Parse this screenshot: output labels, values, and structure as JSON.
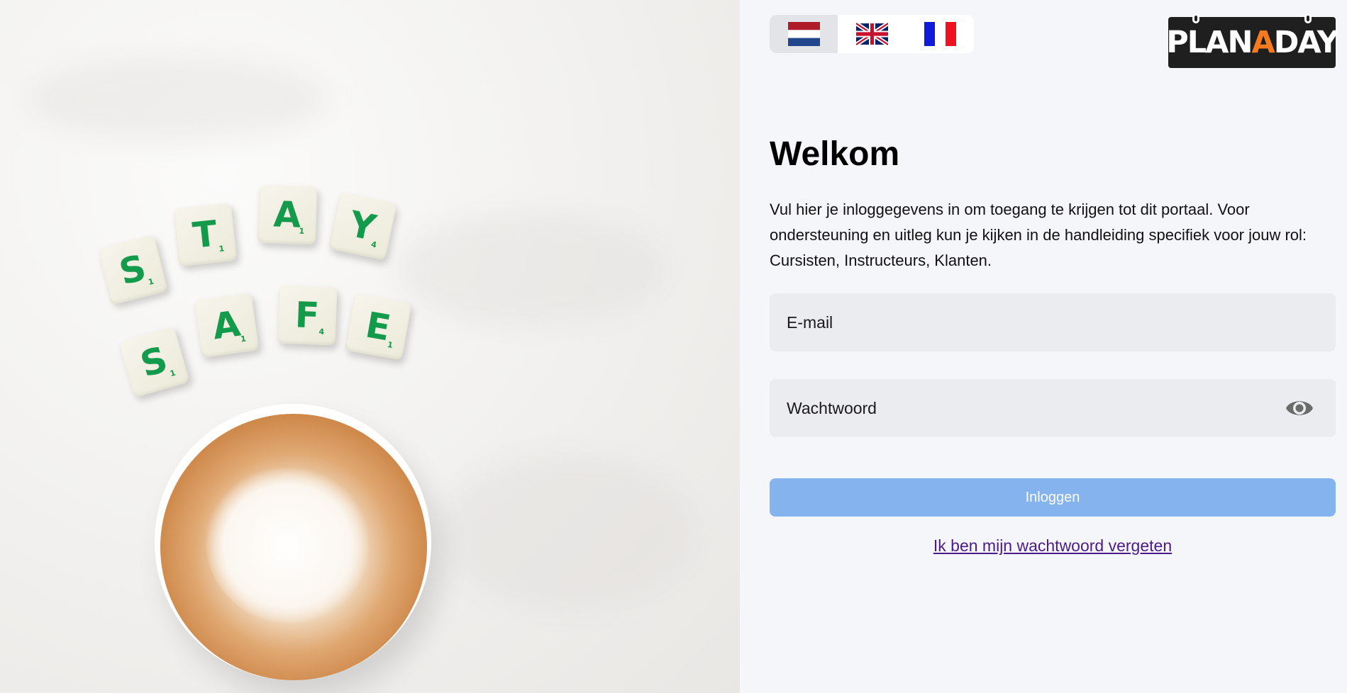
{
  "hero": {
    "tiles": [
      {
        "letter": "S",
        "points": "1"
      },
      {
        "letter": "T",
        "points": "1"
      },
      {
        "letter": "A",
        "points": "1"
      },
      {
        "letter": "Y",
        "points": "4"
      },
      {
        "letter": "S",
        "points": "1"
      },
      {
        "letter": "A",
        "points": "1"
      },
      {
        "letter": "F",
        "points": "4"
      },
      {
        "letter": "E",
        "points": "1"
      }
    ]
  },
  "languages": [
    {
      "code": "nl",
      "icon": "netherlands-flag-icon",
      "active": true
    },
    {
      "code": "en",
      "icon": "uk-flag-icon",
      "active": false
    },
    {
      "code": "fr",
      "icon": "france-flag-icon",
      "active": false
    }
  ],
  "logo": {
    "part1": "PLAN",
    "accent": "A",
    "part2": "DAY",
    "accent_color": "#f47b20"
  },
  "welcome": {
    "title": "Welkom",
    "text": "Vul hier je inloggegevens in om toegang te krijgen tot dit portaal. Voor ondersteuning en uitleg kun je kijken in de handleiding specifiek voor jouw rol: Cursisten, Instructeurs, Klanten."
  },
  "form": {
    "email_placeholder": "E-mail",
    "password_placeholder": "Wachtwoord",
    "login_label": "Inloggen",
    "forgot_label": "Ik ben mijn wachtwoord vergeten"
  },
  "colors": {
    "button": "#84b3ee",
    "link": "#4b1b8c",
    "tile_letter": "#139a4a"
  }
}
